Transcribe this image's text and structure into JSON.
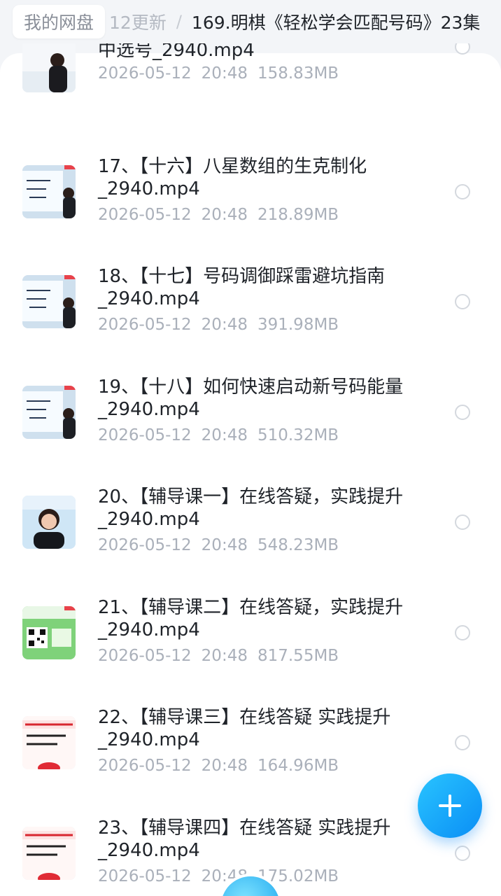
{
  "breadcrumb": {
    "root": "我的网盘",
    "middle": "12更新",
    "separator": "/",
    "current": "169.明棋《轻松学会匹配号码》23集"
  },
  "files": [
    {
      "line1": "中选号_2940.mp4",
      "line2": "",
      "date": "2026-05-12",
      "time": "20:48",
      "size": "158.83MB",
      "thumb": "classroom"
    },
    {
      "line1": "17、【十六】八星数组的生克制化",
      "line2": "_2940.mp4",
      "date": "2026-05-12",
      "time": "20:48",
      "size": "218.89MB",
      "thumb": "board"
    },
    {
      "line1": "18、【十七】号码调御踩雷避坑指南",
      "line2": "_2940.mp4",
      "date": "2026-05-12",
      "time": "20:48",
      "size": "391.98MB",
      "thumb": "board"
    },
    {
      "line1": "19、【十八】如何快速启动新号码能量",
      "line2": "_2940.mp4",
      "date": "2026-05-12",
      "time": "20:48",
      "size": "510.32MB",
      "thumb": "board"
    },
    {
      "line1": "20、【辅导课一】在线答疑，实践提升",
      "line2": "_2940.mp4",
      "date": "2026-05-12",
      "time": "20:48",
      "size": "548.23MB",
      "thumb": "portrait"
    },
    {
      "line1": "21、【辅导课二】在线答疑，实践提升",
      "line2": "_2940.mp4",
      "date": "2026-05-12",
      "time": "20:48",
      "size": "817.55MB",
      "thumb": "qr"
    },
    {
      "line1": "22、【辅导课三】在线答疑 实践提升",
      "line2": "_2940.mp4",
      "date": "2026-05-12",
      "time": "20:48",
      "size": "164.96MB",
      "thumb": "poster"
    },
    {
      "line1": "23、【辅导课四】在线答疑  实践提升",
      "line2": "_2940.mp4",
      "date": "2026-05-12",
      "time": "20:48",
      "size": "175.02MB",
      "thumb": "poster"
    }
  ],
  "fab": {
    "icon": "plus-icon",
    "color": "#1a9cf7"
  },
  "colors": {
    "accent": "#1a9cf7",
    "meta_text": "#aab0ba",
    "title_text": "#1f2329"
  }
}
